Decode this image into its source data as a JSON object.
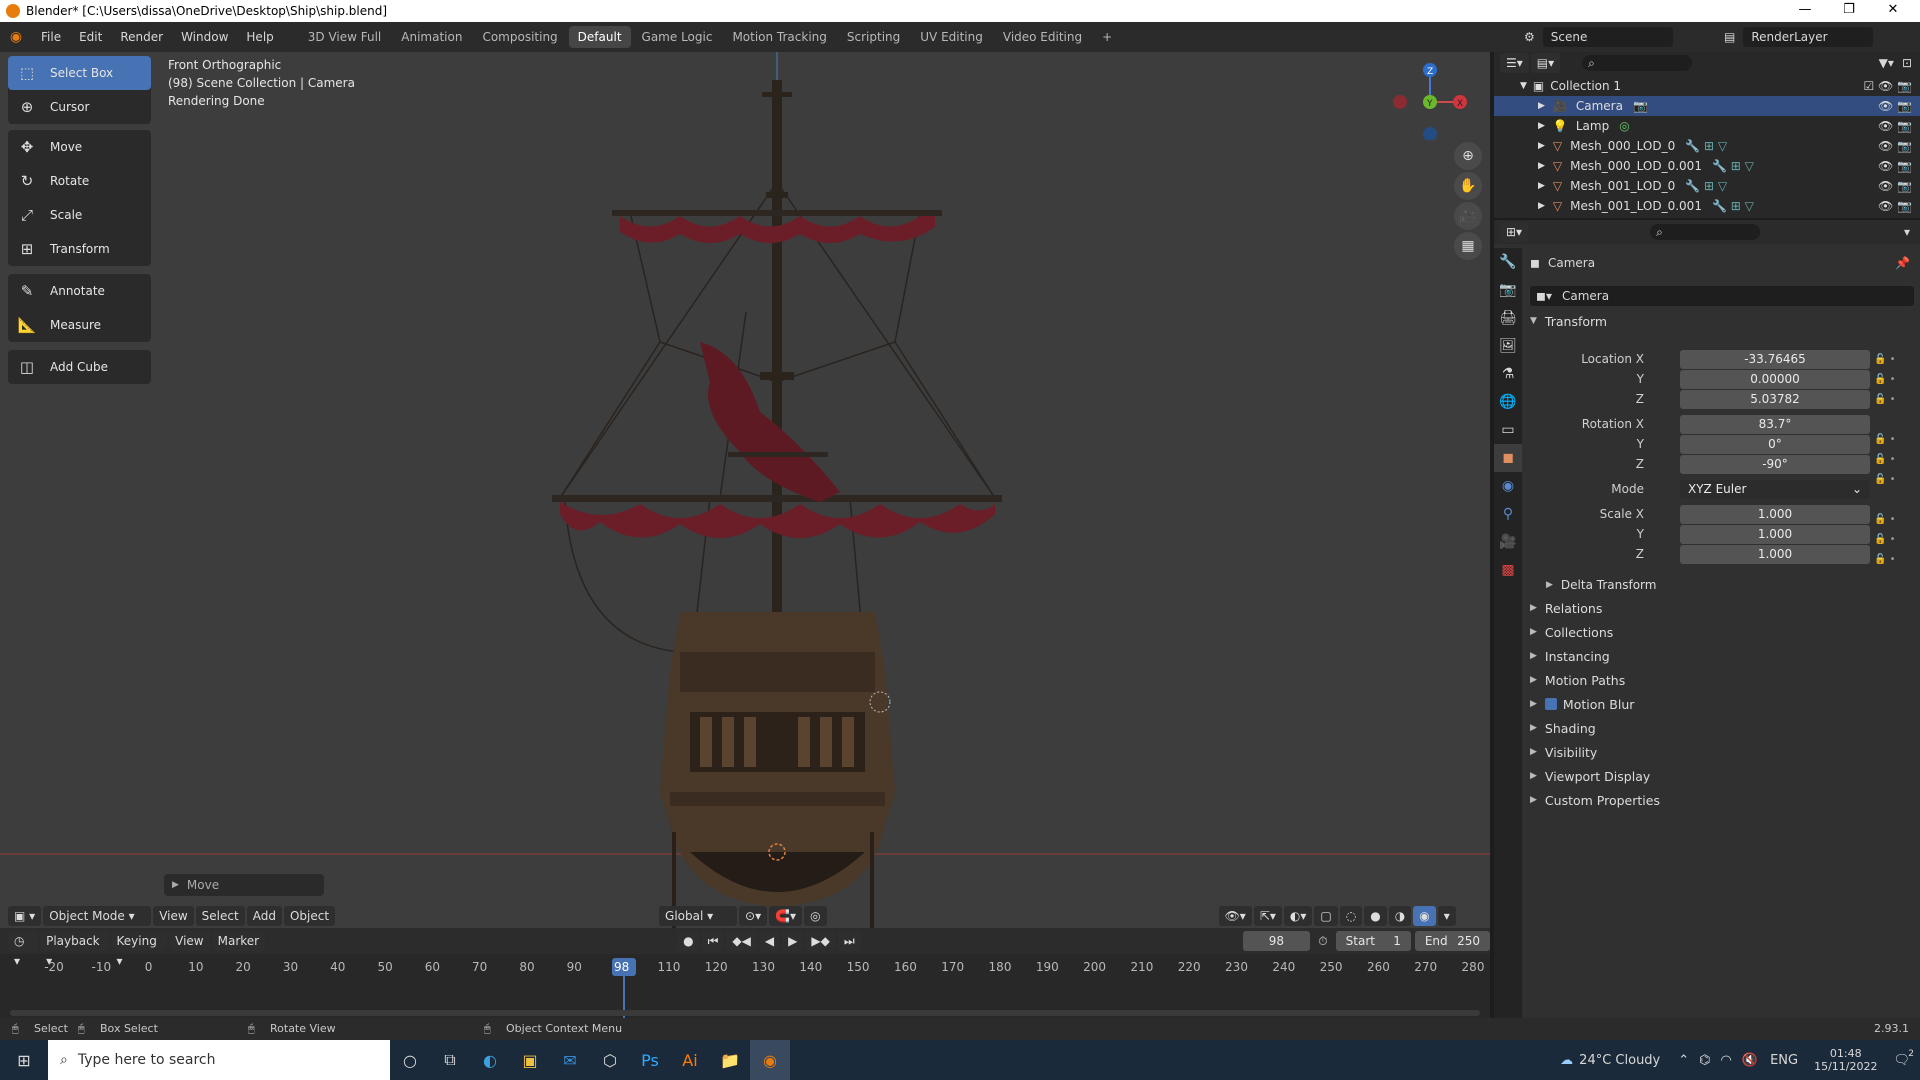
{
  "window": {
    "title": "Blender* [C:\\Users\\dissa\\OneDrive\\Desktop\\Ship\\ship.blend]",
    "minimize": "—",
    "restore": "❐",
    "close": "✕"
  },
  "menu": [
    "File",
    "Edit",
    "Render",
    "Window",
    "Help"
  ],
  "workspaces": [
    "3D View Full",
    "Animation",
    "Compositing",
    "Default",
    "Game Logic",
    "Motion Tracking",
    "Scripting",
    "UV Editing",
    "Video Editing"
  ],
  "workspace_add": "+",
  "scene": {
    "scene_name": "Scene",
    "render_layer": "RenderLayer"
  },
  "viewport": {
    "view_name": "Front Orthographic",
    "collection_info": "(98) Scene Collection | Camera",
    "status": "Rendering Done",
    "last_op": "Move",
    "gizmo": {
      "x": "X",
      "y": "Y",
      "z": "Z"
    },
    "header": {
      "mode": "Object Mode",
      "view": "View",
      "select": "Select",
      "add": "Add",
      "object": "Object",
      "transform_orientation": "Global"
    }
  },
  "toolbar": {
    "groups": [
      [
        {
          "label": "Select Box",
          "icon": "select-box-icon",
          "active": true
        },
        {
          "label": "Cursor",
          "icon": "cursor-icon"
        }
      ],
      [
        {
          "label": "Move",
          "icon": "move-icon"
        },
        {
          "label": "Rotate",
          "icon": "rotate-icon"
        },
        {
          "label": "Scale",
          "icon": "scale-icon"
        },
        {
          "label": "Transform",
          "icon": "transform-icon"
        }
      ],
      [
        {
          "label": "Annotate",
          "icon": "annotate-icon"
        },
        {
          "label": "Measure",
          "icon": "measure-icon"
        }
      ],
      [
        {
          "label": "Add Cube",
          "icon": "add-cube-icon"
        }
      ]
    ]
  },
  "timeline": {
    "menus": [
      "Playback",
      "Keying",
      "View",
      "Marker"
    ],
    "current_frame": "98",
    "start_label": "Start",
    "start": "1",
    "end_label": "End",
    "end": "250",
    "ticks": [
      "-20",
      "-10",
      "0",
      "10",
      "20",
      "30",
      "40",
      "50",
      "60",
      "70",
      "80",
      "90",
      "98",
      "110",
      "120",
      "130",
      "140",
      "150",
      "160",
      "170",
      "180",
      "190",
      "200",
      "210",
      "220",
      "230",
      "240",
      "250",
      "260",
      "270",
      "280"
    ]
  },
  "outliner": {
    "collection": "Collection 1",
    "items": [
      "Camera",
      "Lamp",
      "Mesh_000_LOD_0",
      "Mesh_000_LOD_0.001",
      "Mesh_001_LOD_0",
      "Mesh_001_LOD_0.001"
    ]
  },
  "properties": {
    "object_name": "Camera",
    "datablock": "Camera",
    "transform_title": "Transform",
    "location_label": "Location X",
    "location": [
      "-33.76465",
      "0.00000",
      "5.03782"
    ],
    "rotation_label": "Rotation X",
    "rotation": [
      "83.7°",
      "0°",
      "-90°"
    ],
    "mode_label": "Mode",
    "mode": "XYZ Euler",
    "scale_label": "Scale X",
    "scale": [
      "1.000",
      "1.000",
      "1.000"
    ],
    "axis_y": "Y",
    "axis_z": "Z",
    "delta": "Delta Transform",
    "sections": [
      "Relations",
      "Collections",
      "Instancing",
      "Motion Paths",
      "Motion Blur",
      "Shading",
      "Visibility",
      "Viewport Display",
      "Custom Properties"
    ]
  },
  "statusbar": {
    "select": "Select",
    "box_select": "Box Select",
    "rotate_view": "Rotate View",
    "context_menu": "Object Context Menu",
    "version": "2.93.1"
  },
  "taskbar": {
    "search_placeholder": "Type here to search",
    "weather": "24°C  Cloudy",
    "lang": "ENG",
    "time": "01:48",
    "date": "15/11/2022",
    "notifications": "2"
  },
  "colors": {
    "accent": "#4772b3",
    "viewport_bg": "#3d3d3d",
    "sail": "#6b1e28"
  }
}
